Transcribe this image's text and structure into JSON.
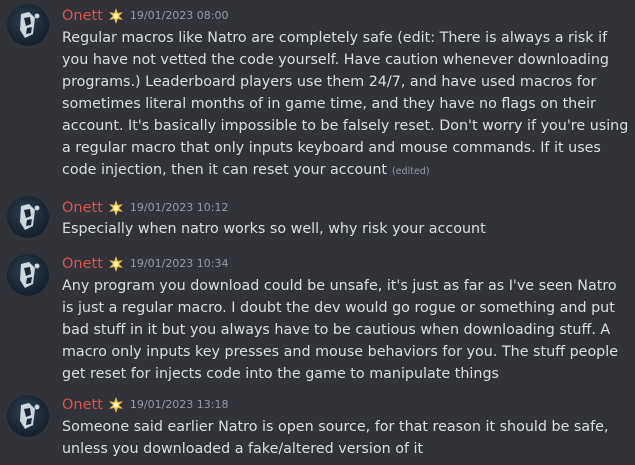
{
  "colors": {
    "background": "#313338",
    "username": "#d9534f",
    "text": "#dbdee1",
    "muted": "#949ba4"
  },
  "messages": [
    {
      "username": "Onett",
      "badge_icon": "star-burst-badge-icon",
      "timestamp": "19/01/2023 08:00",
      "text": "Regular macros like Natro are completely safe (edit: There is always a risk if you have not vetted the code yourself. Have caution whenever downloading programs.) Leaderboard players use them 24/7, and have used macros for sometimes literal months of in game time, and they have no flags on their account. It's basically impossible to be falsely reset. Don't worry if you're using a regular macro that only inputs keyboard and mouse commands. If it uses code injection, then it can reset your account",
      "edited_label": "(edited)"
    },
    {
      "username": "Onett",
      "badge_icon": "star-burst-badge-icon",
      "timestamp": "19/01/2023 10:12",
      "text": "Especially when natro works so well, why risk your account"
    },
    {
      "username": "Onett",
      "badge_icon": "star-burst-badge-icon",
      "timestamp": "19/01/2023 10:34",
      "text": "Any program you download could be unsafe, it's just as far as I've seen Natro is just a regular macro. I doubt the dev would go rogue or something and put bad stuff in it but you always have to be cautious when downloading stuff. A macro only inputs key presses and mouse behaviors for you. The stuff people get reset for injects code into the game to manipulate things"
    },
    {
      "username": "Onett",
      "badge_icon": "star-burst-badge-icon",
      "timestamp": "19/01/2023 13:18",
      "text": "Someone said earlier Natro is open source, for that reason it should be safe, unless you downloaded a fake/altered version of it"
    }
  ]
}
